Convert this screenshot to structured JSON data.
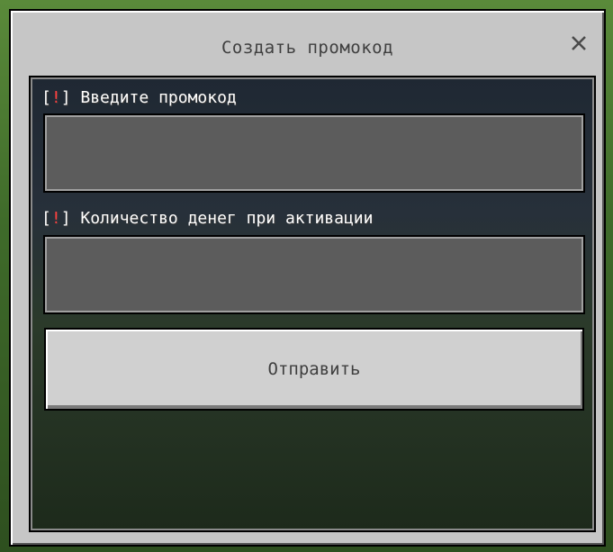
{
  "dialog": {
    "title": "Создать промокод",
    "close_icon": "close-icon"
  },
  "form": {
    "required_marker_open": "[",
    "required_marker_bang": "!",
    "required_marker_close": "]",
    "promo_code": {
      "label": "Введите промокод",
      "value": "",
      "placeholder": ""
    },
    "money_amount": {
      "label": "Количество денег при активации",
      "value": "",
      "placeholder": ""
    },
    "submit_label": "Отправить"
  },
  "colors": {
    "panel": "#c6c6c6",
    "field": "#5c5c5c",
    "required_mark": "#ff4040",
    "label_text": "#ffffff",
    "title_text": "#3f3f3f"
  }
}
